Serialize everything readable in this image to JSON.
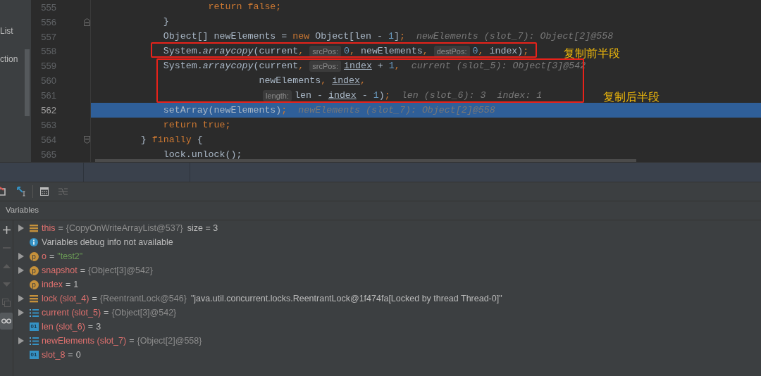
{
  "sidebar": {
    "items": [
      {
        "label": "List"
      },
      {
        "label": "ction"
      }
    ]
  },
  "editor": {
    "lines": [
      {
        "number": "555",
        "selected": false,
        "tokens": [
          {
            "kind": "keyword",
            "text": "                    return false;"
          }
        ]
      },
      {
        "number": "556",
        "selected": false,
        "gutter": {
          "kind": "end"
        },
        "tokens": [
          {
            "kind": "plain",
            "text": "            }"
          }
        ]
      },
      {
        "number": "557",
        "selected": false,
        "tokens": [
          {
            "kind": "plain",
            "text": "            Object[] newElements = "
          },
          {
            "kind": "keyword",
            "text": "new"
          },
          {
            "kind": "plain",
            "text": " Object[len - "
          },
          {
            "kind": "number",
            "text": "1"
          },
          {
            "kind": "plain",
            "text": "]"
          },
          {
            "kind": "keyword",
            "text": ";"
          },
          {
            "kind": "inline",
            "text": "newElements (slot_7): Object[2]@558"
          }
        ]
      },
      {
        "number": "558",
        "selected": false,
        "tokens": [
          {
            "kind": "plain",
            "text": "            System."
          },
          {
            "kind": "method",
            "text": "arraycopy"
          },
          {
            "kind": "plain",
            "text": "(current"
          },
          {
            "kind": "keyword",
            "text": ","
          },
          {
            "kind": "hint",
            "text": "srcPos:"
          },
          {
            "kind": "number",
            "text": "0"
          },
          {
            "kind": "keyword",
            "text": ","
          },
          {
            "kind": "plain",
            "text": " newElements"
          },
          {
            "kind": "keyword",
            "text": ","
          },
          {
            "kind": "hint",
            "text": "destPos:"
          },
          {
            "kind": "number",
            "text": "0"
          },
          {
            "kind": "keyword",
            "text": ","
          },
          {
            "kind": "plain",
            "text": " index)"
          },
          {
            "kind": "keyword",
            "text": ";"
          }
        ]
      },
      {
        "number": "559",
        "selected": false,
        "tokens": [
          {
            "kind": "plain",
            "text": "            System."
          },
          {
            "kind": "method",
            "text": "arraycopy"
          },
          {
            "kind": "plain",
            "text": "(current"
          },
          {
            "kind": "keyword",
            "text": ","
          },
          {
            "kind": "hint",
            "text": "srcPos:"
          },
          {
            "kind": "ref",
            "text": "index"
          },
          {
            "kind": "plain",
            "text": " + "
          },
          {
            "kind": "number",
            "text": "1"
          },
          {
            "kind": "keyword",
            "text": ","
          },
          {
            "kind": "inline",
            "text": "current (slot_5): Object[3]@542"
          }
        ]
      },
      {
        "number": "560",
        "selected": false,
        "tokens": [
          {
            "kind": "plain",
            "text": "                             newElements"
          },
          {
            "kind": "keyword",
            "text": ", "
          },
          {
            "kind": "ref",
            "text": "index"
          },
          {
            "kind": "keyword",
            "text": ","
          }
        ]
      },
      {
        "number": "561",
        "selected": false,
        "tokens": [
          {
            "kind": "hint",
            "text": "length:"
          },
          {
            "kind": "plain",
            "text": "len - "
          },
          {
            "kind": "ref",
            "text": "index"
          },
          {
            "kind": "plain",
            "text": " - "
          },
          {
            "kind": "number",
            "text": "1"
          },
          {
            "kind": "plain",
            "text": ")"
          },
          {
            "kind": "keyword",
            "text": ";"
          },
          {
            "kind": "inline",
            "text": "len (slot_6): 3"
          },
          {
            "kind": "inline",
            "text": "index: 1"
          }
        ]
      },
      {
        "number": "562",
        "selected": true,
        "tokens": [
          {
            "kind": "plain",
            "text": "            setArray(newElements)"
          },
          {
            "kind": "keyword",
            "text": ";"
          },
          {
            "kind": "inline",
            "text": "newElements (slot_7): Object[2]@558"
          }
        ]
      },
      {
        "number": "563",
        "selected": false,
        "tokens": [
          {
            "kind": "keyword",
            "text": "            return true;"
          }
        ]
      },
      {
        "number": "564",
        "selected": false,
        "gutter": {
          "kind": "start"
        },
        "tokens": [
          {
            "kind": "plain",
            "text": "        } "
          },
          {
            "kind": "keyword",
            "text": "finally"
          },
          {
            "kind": "plain",
            "text": " {"
          }
        ]
      },
      {
        "number": "565",
        "selected": false,
        "tokens": [
          {
            "kind": "plain",
            "text": "            lock.unlock();"
          }
        ]
      }
    ]
  },
  "annotations": [
    {
      "text": "复制前半段"
    },
    {
      "text": "复制后半段"
    }
  ],
  "watches_toggle": {
    "on": true
  },
  "variables": {
    "title": "Variables",
    "rows": [
      {
        "kind": "field",
        "expandable": true,
        "name": "this",
        "eq": "=",
        "value": {
          "kind": "ref",
          "text": "{CopyOnWriteArrayList@537}"
        },
        "extra": "size = 3"
      },
      {
        "kind": "info",
        "expandable": false,
        "text": "Variables debug info not available"
      },
      {
        "kind": "param",
        "badge": "p",
        "expandable": true,
        "name": "o",
        "eq": "=",
        "value": {
          "kind": "string",
          "text": "\"test2\""
        }
      },
      {
        "kind": "param",
        "badge": "p",
        "expandable": true,
        "name": "snapshot",
        "eq": "=",
        "value": {
          "kind": "ref",
          "text": "{Object[3]@542}"
        }
      },
      {
        "kind": "param",
        "badge": "p",
        "expandable": false,
        "name": "index",
        "eq": "=",
        "value": {
          "kind": "plain",
          "text": "1"
        }
      },
      {
        "kind": "field",
        "expandable": true,
        "name": "lock (slot_4)",
        "eq": "=",
        "value": {
          "kind": "ref",
          "text": "{ReentrantLock@546}"
        },
        "extra": "\"java.util.concurrent.locks.ReentrantLock@1f474fa[Locked by thread Thread-0]\""
      },
      {
        "kind": "array",
        "expandable": true,
        "name": "current (slot_5)",
        "eq": "=",
        "value": {
          "kind": "ref",
          "text": "{Object[3]@542}"
        }
      },
      {
        "kind": "primitive",
        "badge": "01",
        "expandable": false,
        "name": "len (slot_6)",
        "eq": "=",
        "value": {
          "kind": "plain",
          "text": "3"
        }
      },
      {
        "kind": "array",
        "expandable": true,
        "name": "newElements (slot_7)",
        "eq": "=",
        "value": {
          "kind": "ref",
          "text": "{Object[2]@558}"
        }
      },
      {
        "kind": "primitive",
        "badge": "01",
        "expandable": false,
        "name": "slot_8",
        "eq": "=",
        "value": {
          "kind": "plain",
          "text": "0"
        }
      }
    ]
  }
}
